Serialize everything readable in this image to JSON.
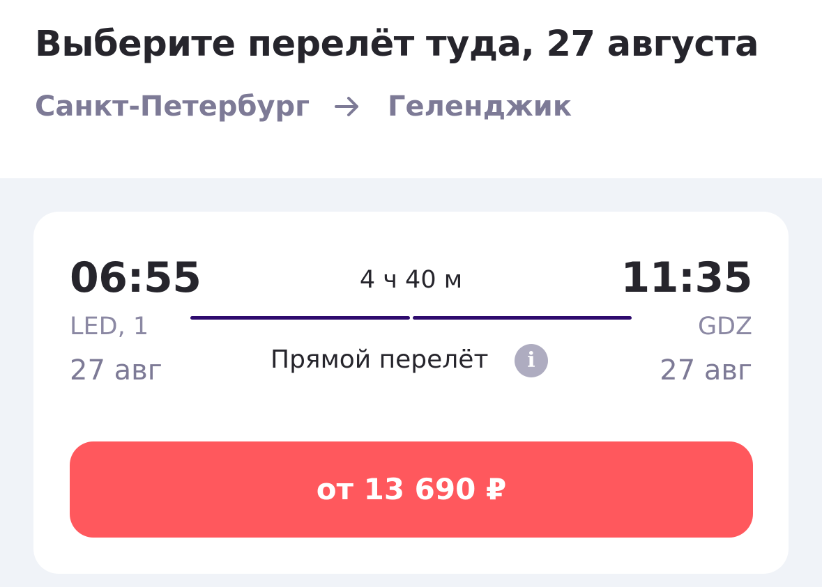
{
  "header": {
    "title": "Выберите перелёт туда, 27 августа",
    "route": {
      "from": "Санкт-Петербург",
      "arrow_icon": "arrow-right-icon",
      "to": "Геленджик"
    }
  },
  "flight": {
    "departure": {
      "time": "06:55",
      "airport": "LED, 1",
      "date": "27 авг"
    },
    "arrival": {
      "time": "11:35",
      "airport": "GDZ",
      "date": "27 авг"
    },
    "duration": "4 ч 40 м",
    "type": "Прямой перелёт",
    "info_icon": "i"
  },
  "price_button": {
    "label": "от 13 690 ₽"
  },
  "colors": {
    "title": "#26252c",
    "secondary": "#7d7a96",
    "route_line": "#2e0b6e",
    "background": "#f0f3f8",
    "card": "#ffffff",
    "accent": "#ff585d",
    "info_icon": "#aeacc0"
  }
}
